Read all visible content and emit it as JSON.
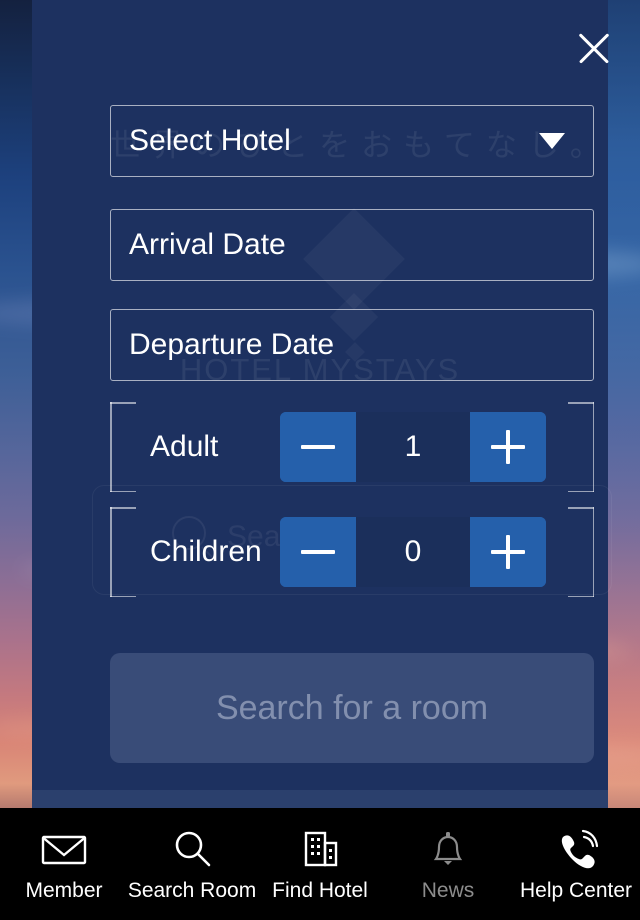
{
  "background": {
    "watermark_japanese": "世界のひとをおもてなし。",
    "watermark_brand": "HOTEL MYSTAYS",
    "underlying_search_placeholder": "Search for a room"
  },
  "modal": {
    "close_label": "Close",
    "fields": [
      {
        "name": "select-hotel",
        "label": "Select Hotel",
        "value": "",
        "has_caret": true
      },
      {
        "name": "arrival-date",
        "label": "Arrival Date",
        "value": "",
        "has_caret": false
      },
      {
        "name": "departure-date",
        "label": "Departure Date",
        "value": "",
        "has_caret": false
      }
    ],
    "steppers": [
      {
        "name": "adult",
        "label": "Adult",
        "value": "1",
        "minus": "−",
        "plus": "+"
      },
      {
        "name": "children",
        "label": "Children",
        "value": "0",
        "minus": "−",
        "plus": "+"
      }
    ],
    "submit_label": "Search for a room",
    "submit_enabled": false
  },
  "bottom_nav": {
    "items": [
      {
        "label": "Member",
        "icon": "envelope-icon",
        "active": true
      },
      {
        "label": "Search Room",
        "icon": "magnifier-icon",
        "active": true
      },
      {
        "label": "Find Hotel",
        "icon": "building-icon",
        "active": true
      },
      {
        "label": "News",
        "icon": "bell-icon",
        "active": false
      },
      {
        "label": "Help Center",
        "icon": "phone-icon",
        "active": true
      }
    ]
  },
  "colors": {
    "overlay": "#1d3160",
    "stepper_button": "#2560ab",
    "stepper_value_bg": "#1b2f5b",
    "nav_bg": "#000000",
    "text": "#ffffff"
  }
}
